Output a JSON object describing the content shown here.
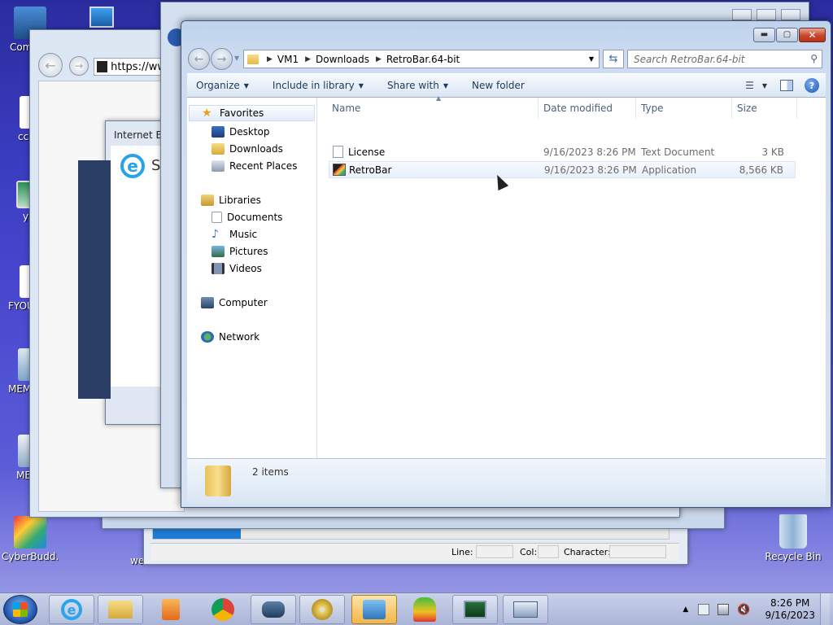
{
  "desktop": {
    "icons": [
      {
        "label": "Com"
      },
      {
        "label": "cc"
      },
      {
        "label": "y"
      },
      {
        "label": "FYOU"
      },
      {
        "label": "MEM"
      },
      {
        "label": "ME"
      },
      {
        "label": "CyberBudd..."
      },
      {
        "label": "we"
      },
      {
        "label": "Recycle Bin"
      }
    ]
  },
  "background_windows": {
    "browser_url": "https://ww",
    "ie_dialog_title": "Internet Ex",
    "ie_dialog_text": "S",
    "notepad_status": {
      "line": "Line:",
      "col": "Col:",
      "character": "Character:"
    }
  },
  "explorer": {
    "breadcrumb": [
      "VM1",
      "Downloads",
      "RetroBar.64-bit"
    ],
    "search_placeholder": "Search RetroBar.64-bit",
    "toolbar": {
      "organize": "Organize",
      "include": "Include in library",
      "share": "Share with",
      "new_folder": "New folder"
    },
    "nav": {
      "favorites": "Favorites",
      "desktop": "Desktop",
      "downloads": "Downloads",
      "recent": "Recent Places",
      "libraries": "Libraries",
      "documents": "Documents",
      "music": "Music",
      "pictures": "Pictures",
      "videos": "Videos",
      "computer": "Computer",
      "network": "Network"
    },
    "columns": {
      "name": "Name",
      "date": "Date modified",
      "type": "Type",
      "size": "Size"
    },
    "files": [
      {
        "name": "License",
        "date": "9/16/2023 8:26 PM",
        "type": "Text Document",
        "size": "3 KB"
      },
      {
        "name": "RetroBar",
        "date": "9/16/2023 8:26 PM",
        "type": "Application",
        "size": "8,566 KB"
      }
    ],
    "status": "2 items"
  },
  "taskbar": {
    "clock_time": "8:26 PM",
    "clock_date": "9/16/2023"
  }
}
